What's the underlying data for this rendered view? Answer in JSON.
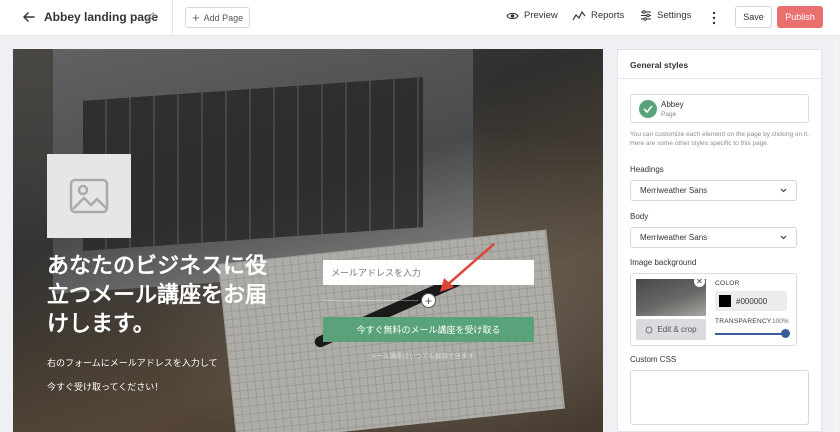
{
  "header": {
    "title": "Abbey landing page",
    "add_page": "Add Page",
    "nav": {
      "preview": "Preview",
      "reports": "Reports",
      "settings": "Settings"
    },
    "save": "Save",
    "publish": "Publish"
  },
  "hero": {
    "heading": "あなたのビジネスに役立つメール講座をお届けします。",
    "subtext_line1": "右のフォームにメールアドレスを入力して",
    "subtext_line2": "今すぐ受け取ってください！",
    "email_placeholder": "メールアドレスを入力",
    "cta_label": "今すぐ無料のメール講座を受け取る",
    "cta_note": "メール講座はいつでも解除できます。"
  },
  "panel": {
    "title": "General styles",
    "page_card": {
      "name": "Abbey",
      "type": "Page"
    },
    "help_text": "You can customize each element on the page by clicking on it. Here are some other styles specific to this page.",
    "headings_label": "Headings",
    "headings_value": "Merriweather Sans",
    "body_label": "Body",
    "body_value": "Merriweather Sans",
    "image_bg_label": "Image background",
    "edit_crop": "Edit & crop",
    "color_label": "COLOR",
    "color_value": "#000000",
    "transparency_label": "TRANSPARENCY",
    "transparency_value": "100%",
    "custom_css_label": "Custom CSS"
  },
  "colors": {
    "publish": "#ea7070",
    "cta": "#5aa27a",
    "slider": "#3a5b9c"
  }
}
